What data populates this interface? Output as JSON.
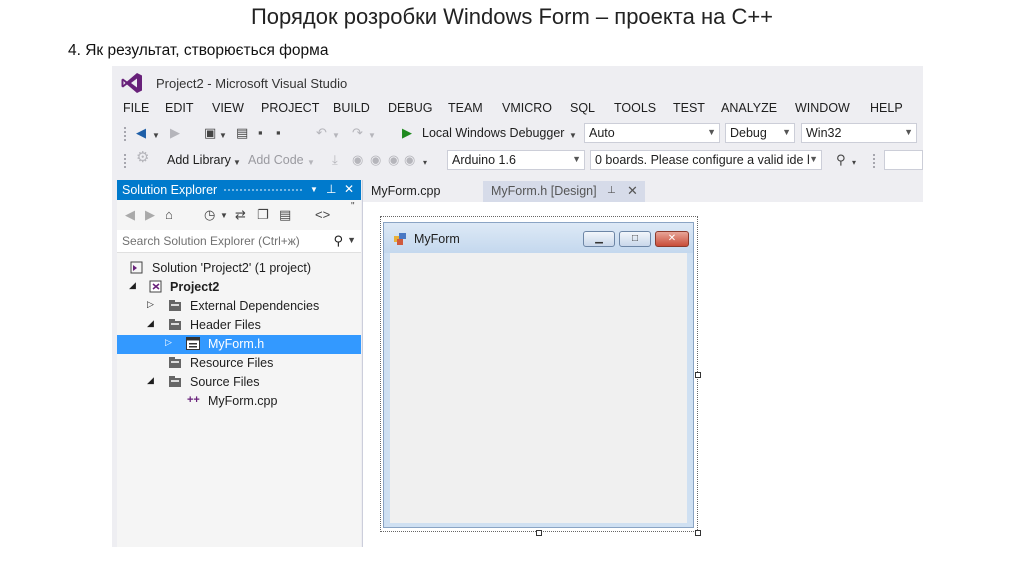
{
  "slide": {
    "title": "Порядок розробки  Windows Form – проекта на C++",
    "subtitle": "4. Як результат, створюється форма"
  },
  "app": {
    "title": "Project2 - Microsoft Visual Studio",
    "accent_color": "#007acc",
    "logo_color": "#68217a"
  },
  "menu": [
    "FILE",
    "EDIT",
    "VIEW",
    "PROJECT",
    "BUILD",
    "DEBUG",
    "TEAM",
    "VMICRO",
    "SQL",
    "TOOLS",
    "TEST",
    "ANALYZE",
    "WINDOW",
    "HELP"
  ],
  "toolbar1": {
    "debugger_label": "Local Windows Debugger",
    "solution_platform_combo": "Auto",
    "config_combo": "Debug",
    "platform_combo": "Win32"
  },
  "toolbar2": {
    "add_library": "Add Library",
    "add_code": "Add Code",
    "board_combo": "Arduino 1.6",
    "port_combo": "0 boards. Please configure a valid ide l"
  },
  "solution_explorer": {
    "title": "Solution Explorer",
    "search_placeholder": "Search Solution Explorer (Ctrl+ж)",
    "tree": [
      {
        "label": "Solution 'Project2' (1 project)",
        "icon": "solution-icon",
        "bold": false
      },
      {
        "label": "Project2",
        "icon": "project-icon",
        "bold": true,
        "expanded": true
      },
      {
        "label": "External Dependencies",
        "icon": "filter-folder-icon",
        "expanded": false
      },
      {
        "label": "Header Files",
        "icon": "filter-folder-icon",
        "expanded": true
      },
      {
        "label": "MyForm.h",
        "icon": "form-file-icon",
        "selected": true
      },
      {
        "label": "Resource Files",
        "icon": "filter-folder-icon"
      },
      {
        "label": "Source Files",
        "icon": "filter-folder-icon",
        "expanded": true
      },
      {
        "label": "MyForm.cpp",
        "icon": "cpp-file-icon"
      }
    ]
  },
  "tabs": [
    {
      "label": "MyForm.cpp",
      "active": false
    },
    {
      "label": "MyForm.h [Design]",
      "active": true
    }
  ],
  "designer": {
    "form_caption": "MyForm"
  }
}
